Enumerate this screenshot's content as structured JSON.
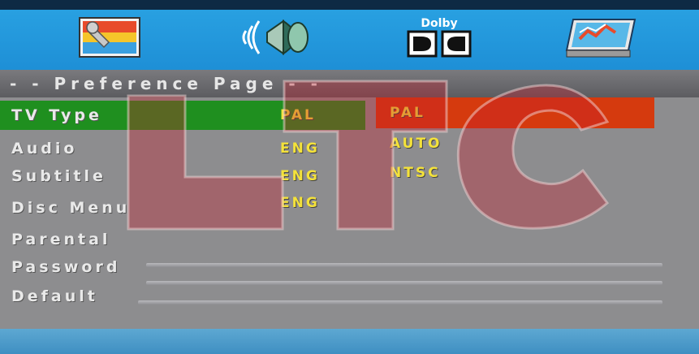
{
  "header": {
    "icons": [
      {
        "name": "general-setup-icon"
      },
      {
        "name": "audio-setup-icon"
      },
      {
        "name": "dolby-setup-icon",
        "text": "Dolby"
      },
      {
        "name": "preference-setup-icon"
      }
    ]
  },
  "page": {
    "title": "- -  Preference  Page  - -"
  },
  "menu": {
    "items": [
      {
        "label": "TV  Type",
        "value": "PAL"
      },
      {
        "label": "Audio",
        "value": "ENG"
      },
      {
        "label": "Subtitle",
        "value": "ENG"
      },
      {
        "label": "Disc  Menu",
        "value": "ENG"
      },
      {
        "label": "Parental",
        "value": ""
      },
      {
        "label": "Password",
        "value": ""
      },
      {
        "label": "Default",
        "value": ""
      }
    ]
  },
  "options": {
    "items": [
      "PAL",
      "AUTO",
      "NTSC"
    ],
    "selected": "PAL"
  },
  "watermark": {
    "text": "LTC"
  },
  "colors": {
    "top_bar": "#1e8fd6",
    "highlight_row": "#1f8f1f",
    "option_highlight": "#d53a0e",
    "value_text": "#f4e23a",
    "background": "#8d8d8f"
  }
}
